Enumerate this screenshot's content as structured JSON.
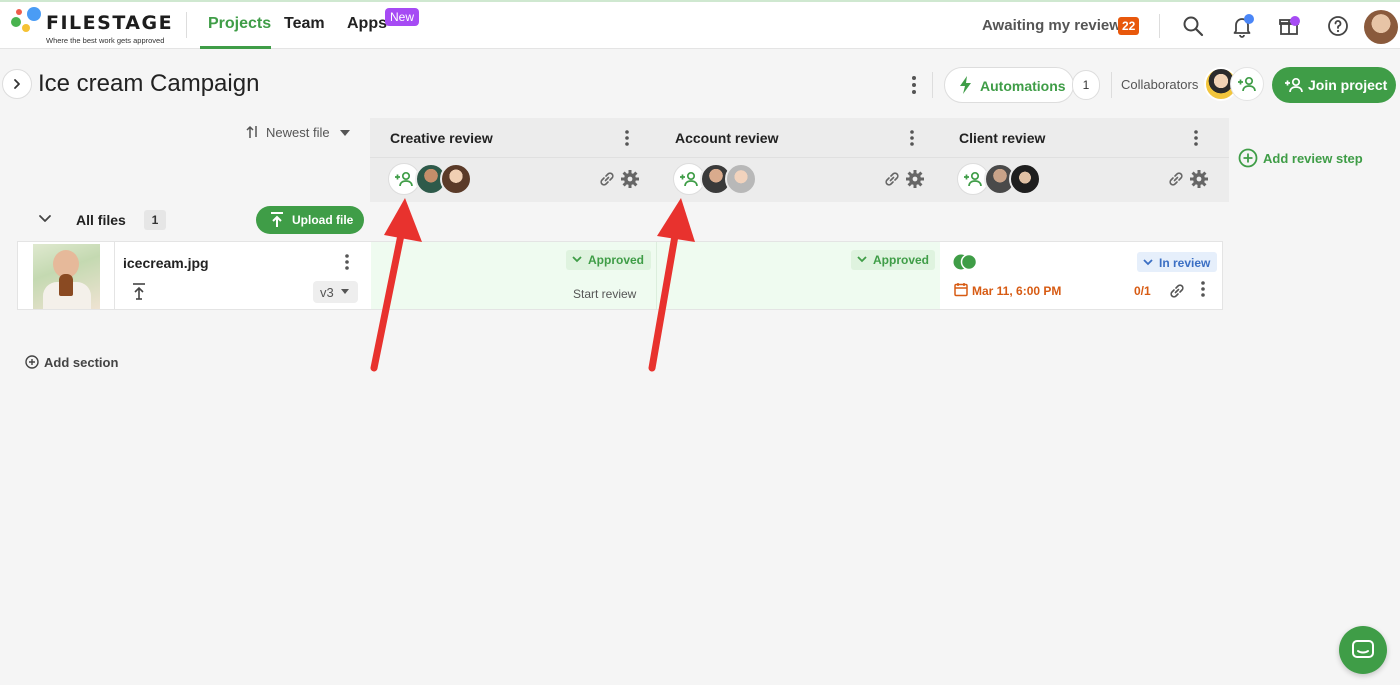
{
  "brand": {
    "name": "FILESTAGE",
    "tagline": "Where the best work gets approved",
    "primary_color": "#3f9d47"
  },
  "nav": {
    "items": [
      {
        "label": "Projects",
        "active": true
      },
      {
        "label": "Team",
        "active": false
      },
      {
        "label": "Apps",
        "active": false
      }
    ],
    "apps_badge": "New",
    "awaiting_label": "Awaiting my review",
    "awaiting_count": "22",
    "icons": [
      "search-icon",
      "bell-icon",
      "gift-icon",
      "help-icon"
    ]
  },
  "project": {
    "title": "Ice cream Campaign",
    "automations_label": "Automations",
    "automations_count": "1",
    "collaborators_label": "Collaborators",
    "join_label": "Join project"
  },
  "board": {
    "sort_label": "Newest file",
    "steps": [
      {
        "title": "Creative review"
      },
      {
        "title": "Account review"
      },
      {
        "title": "Client review"
      }
    ],
    "add_step_label": "Add review step",
    "section": {
      "name": "All files",
      "count": "1",
      "upload_label": "Upload file"
    },
    "file": {
      "name": "icecream.jpg",
      "version": "v3",
      "statuses": [
        {
          "label": "Approved",
          "action": "Start review"
        },
        {
          "label": "Approved"
        },
        {
          "label": "In review",
          "due": "Mar 11, 6:00 PM",
          "progress": "0/1"
        }
      ]
    },
    "add_section_label": "Add section"
  },
  "annotations": {
    "arrow_color": "#e8322e"
  }
}
